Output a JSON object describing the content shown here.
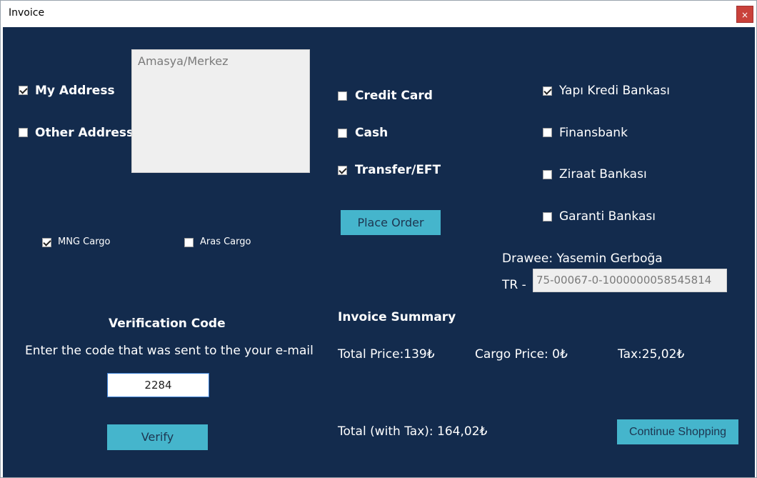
{
  "window": {
    "title": "Invoice",
    "close_label": "×"
  },
  "address": {
    "my_address_label": "My Address",
    "my_address_checked": true,
    "other_address_label": "Other Address",
    "other_address_checked": false,
    "address_text": "Amasya/Merkez"
  },
  "payment": {
    "credit_card_label": "Credit Card",
    "credit_card_checked": false,
    "cash_label": "Cash",
    "cash_checked": false,
    "transfer_label": "Transfer/EFT",
    "transfer_checked": true
  },
  "banks": {
    "yapi_kredi_label": "Yapı Kredi Bankası",
    "yapi_kredi_checked": true,
    "finansbank_label": "Finansbank",
    "finansbank_checked": false,
    "ziraat_label": "Ziraat Bankası",
    "ziraat_checked": false,
    "garanti_label": "Garanti Bankası",
    "garanti_checked": false
  },
  "order": {
    "place_order_label": "Place Order"
  },
  "cargo": {
    "mng_label": "MNG Cargo",
    "mng_checked": true,
    "aras_label": "Aras Cargo",
    "aras_checked": false
  },
  "drawee": {
    "label": "Drawee: Yasemin Gerboğa",
    "iban_prefix": "TR -",
    "iban_value": "75-00067-0-1000000058545814"
  },
  "verification": {
    "title": "Verification Code",
    "instruction": "Enter the code that was  sent to the your e-mail",
    "code_value": "2284",
    "verify_label": "Verify"
  },
  "summary": {
    "title": "Invoice Summary",
    "total_price": "Total Price:139₺",
    "cargo_price": "Cargo Price: 0₺",
    "tax": "Tax:25,02₺",
    "total_with_tax": "Total (with Tax): 164,02₺",
    "continue_label": "Continue Shopping"
  },
  "colors": {
    "background": "#132b4d",
    "button": "#45b5cc",
    "close": "#c9413a"
  }
}
